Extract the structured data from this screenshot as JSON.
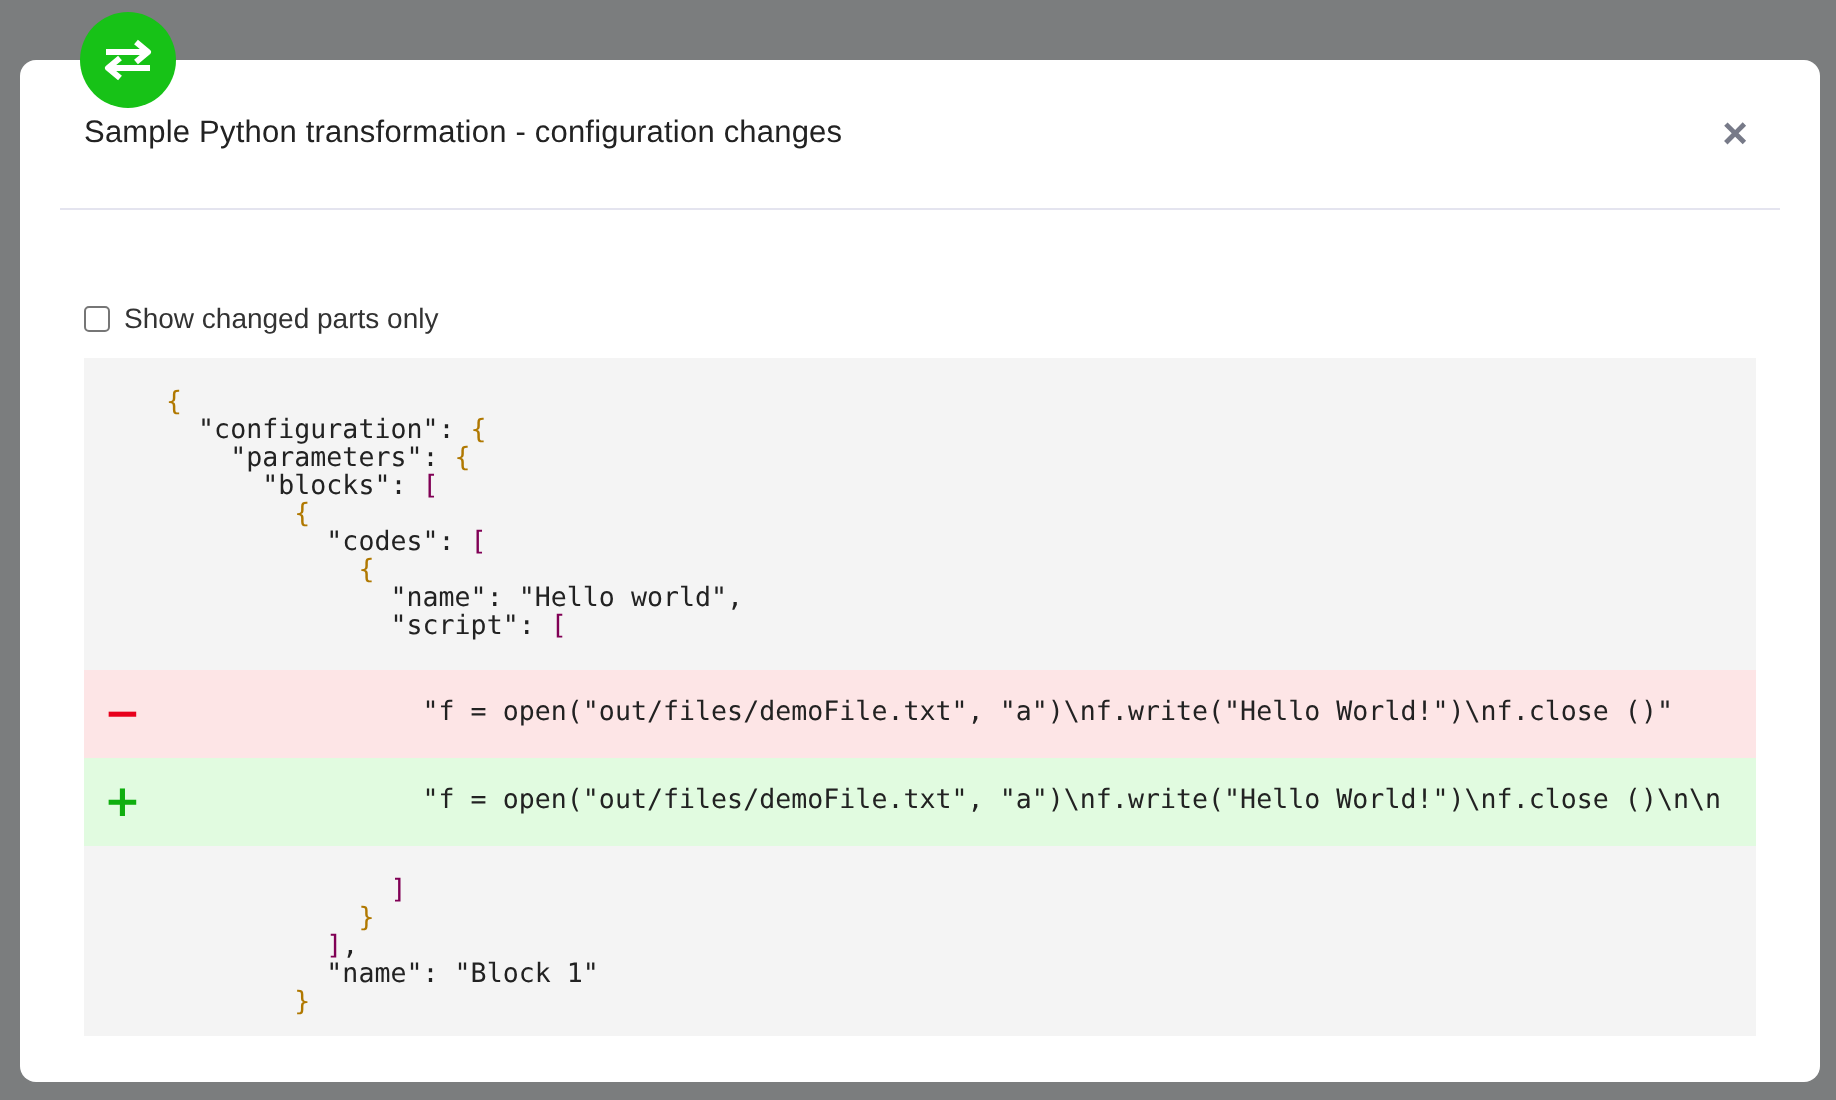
{
  "modal": {
    "title": "Sample Python transformation - configuration changes",
    "close": "×",
    "show_changed_only": {
      "label": "Show changed parts only",
      "checked": false
    },
    "code_before": [
      "{",
      "  \"configuration\": {",
      "    \"parameters\": {",
      "      \"blocks\": [",
      "        {",
      "          \"codes\": [",
      "            {",
      "              \"name\": \"Hello world\",",
      "              \"script\": ["
    ],
    "diff": [
      {
        "kind": "removed",
        "sign": "−",
        "text": "                \"f = open(\"out/files/demoFile.txt\", \"a\")\\nf.write(\"Hello World!\")\\nf.close ()\""
      },
      {
        "kind": "added",
        "sign": "+",
        "text": "                \"f = open(\"out/files/demoFile.txt\", \"a\")\\nf.write(\"Hello World!\")\\nf.close ()\\n\\n"
      }
    ],
    "code_after": [
      "              ]",
      "            }",
      "          ],",
      "          \"name\": \"Block 1\"",
      "        }"
    ]
  }
}
